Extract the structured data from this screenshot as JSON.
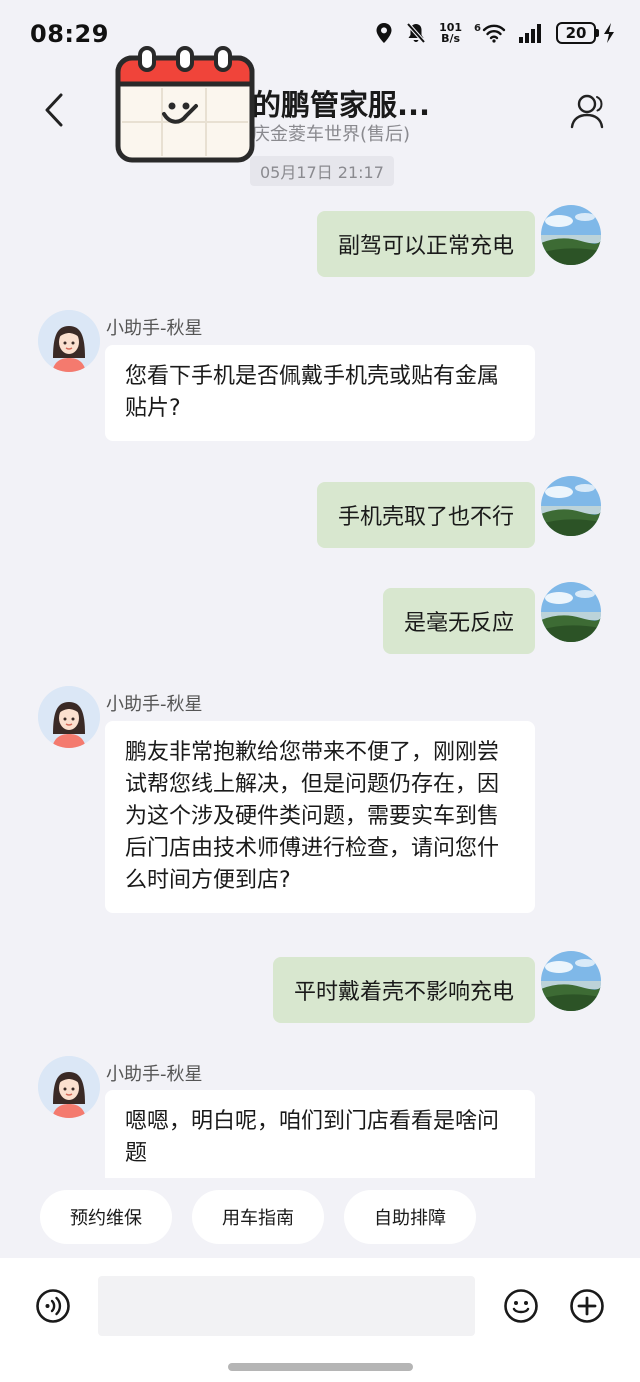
{
  "status_bar": {
    "time": "08:29",
    "net_speed_value": "101",
    "net_speed_unit": "B/s",
    "network_gen": "6",
    "battery": "20"
  },
  "header": {
    "title": "的鹏管家服...",
    "subtitle": "庆金菱车世界(售后)"
  },
  "timestamp": "05月17日 21:17",
  "agent_name": "小助手-秋星",
  "messages": [
    {
      "from": "user",
      "text": "副驾可以正常充电"
    },
    {
      "from": "agent",
      "name": "小助手-秋星",
      "text": "您看下手机是否佩戴手机壳或贴有金属贴片?"
    },
    {
      "from": "user",
      "text": "手机壳取了也不行"
    },
    {
      "from": "user",
      "text": "是毫无反应"
    },
    {
      "from": "agent",
      "name": "小助手-秋星",
      "text": "鹏友非常抱歉给您带来不便了，刚刚尝试帮您线上解决，但是问题仍存在，因为这个涉及硬件类问题，需要实车到售后门店由技术师傅进行检查，请问您什么时间方便到店?"
    },
    {
      "from": "user",
      "text": "平时戴着壳不影响充电"
    },
    {
      "from": "agent",
      "name": "小助手-秋星",
      "text": "嗯嗯，明白呢，咱们到门店看看是啥问题"
    }
  ],
  "quick_replies": [
    "预约维保",
    "用车指南",
    "自助排障"
  ],
  "input": {
    "placeholder": ""
  },
  "colors": {
    "background": "#f2f2f7",
    "user_bubble": "#d8e7cf",
    "agent_bubble": "#ffffff",
    "sticker_red": "#f0443a"
  },
  "icons": [
    "back-arrow-icon",
    "profile-icon",
    "calendar-sticker-icon",
    "voice-icon",
    "emoji-icon",
    "plus-icon"
  ]
}
